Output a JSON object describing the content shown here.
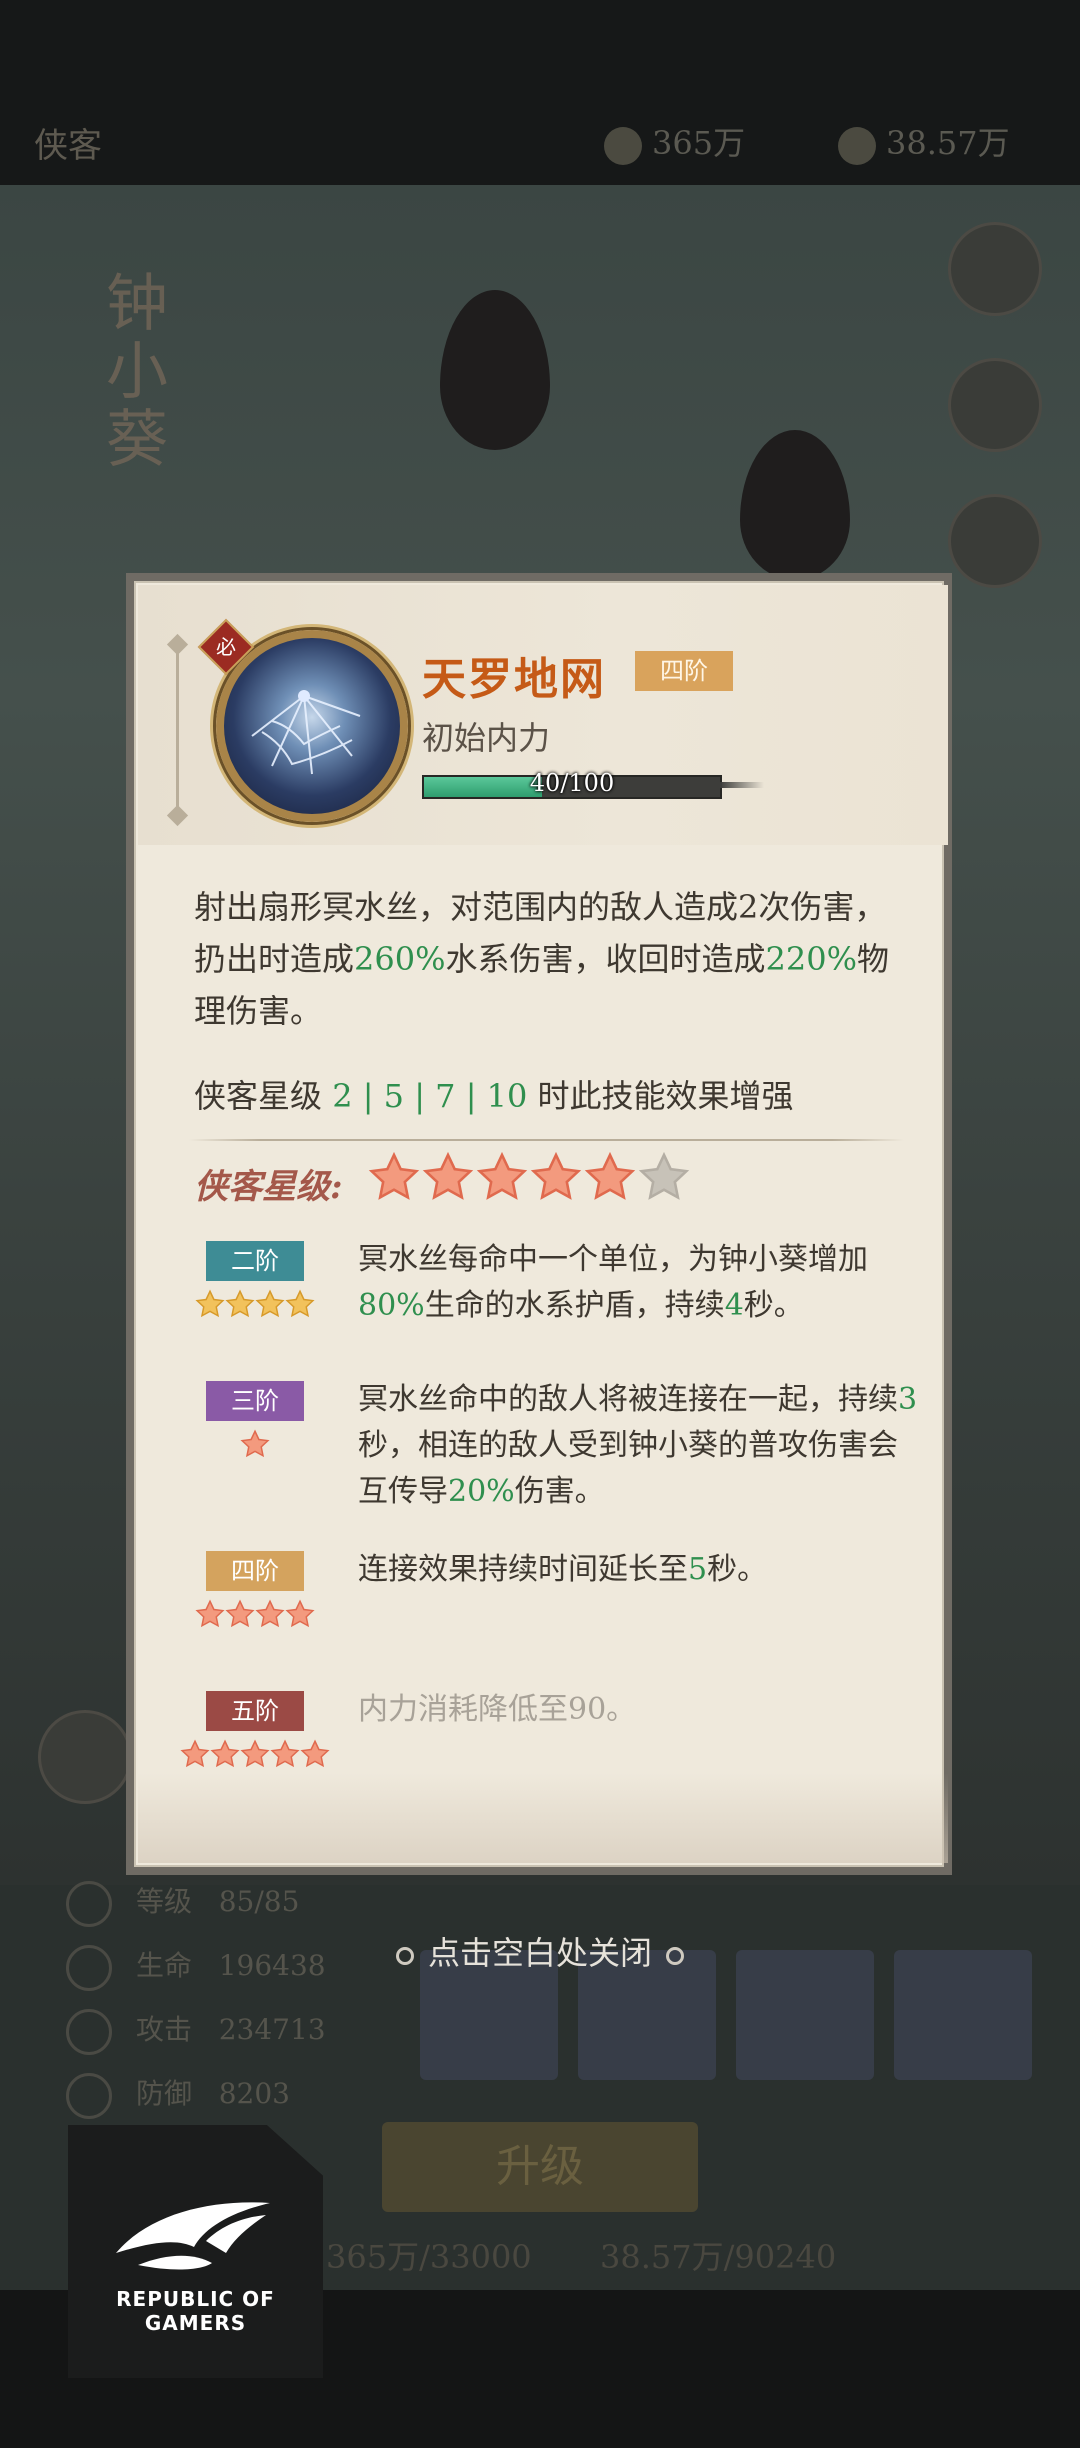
{
  "background": {
    "top_left_title": "侠客",
    "currency_1": "365万",
    "currency_2": "38.57万",
    "character_name": "钟小葵",
    "stats": [
      {
        "label": "等级",
        "value": "85/85"
      },
      {
        "label": "生命",
        "value": "196438"
      },
      {
        "label": "攻击",
        "value": "234713"
      },
      {
        "label": "防御",
        "value": "8203"
      }
    ],
    "upgrade_label": "升级",
    "cost_1": "365万/33000",
    "cost_2": "38.57万/90240"
  },
  "rog": {
    "line1": "REPUBLIC OF",
    "line2": "GAMERS"
  },
  "popup": {
    "skill_name": "天罗地网",
    "tier_badge": "四阶",
    "subtitle": "初始内力",
    "energy_text": "40/100",
    "energy_current": 40,
    "energy_max": 100,
    "must_badge": "必",
    "description": {
      "part1": "射出扇形冥水丝，对范围内的敌人造成2次伤害，扔出时造成",
      "value1": "260%",
      "part2": "水系伤害，收回时造成",
      "value2": "220%",
      "part3": "物理伤害。"
    },
    "boost": {
      "prefix": "侠客星级",
      "levels": "2 | 5 | 7 | 10",
      "suffix": "时此技能效果增强"
    },
    "star_label": "侠客星级:",
    "hero_stars": 5,
    "hero_stars_max": 6,
    "tiers": [
      {
        "tag": "二阶",
        "tag_color": "#3e8c95",
        "stars": 4,
        "star_color": "gold",
        "parts": [
          [
            "冥水丝每命中一个单位，为钟小葵增加",
            false
          ],
          [
            "80%",
            true
          ],
          [
            "生命的水系护盾，持续",
            false
          ],
          [
            "4",
            true
          ],
          [
            "秒。",
            false
          ]
        ]
      },
      {
        "tag": "三阶",
        "tag_color": "#8a5aa6",
        "stars": 1,
        "star_color": "red",
        "parts": [
          [
            "冥水丝命中的敌人将被连接在一起，持续",
            false
          ],
          [
            "3",
            true
          ],
          [
            "秒，相连的敌人受到钟小葵的普攻伤害会互传导",
            false
          ],
          [
            "20%",
            true
          ],
          [
            "伤害。",
            false
          ]
        ]
      },
      {
        "tag": "四阶",
        "tag_color": "#d4a35e",
        "stars": 4,
        "star_color": "red",
        "parts": [
          [
            "连接效果持续时间延长至",
            false
          ],
          [
            "5",
            true
          ],
          [
            "秒。",
            false
          ]
        ]
      },
      {
        "tag": "五阶",
        "tag_color": "#9b4a45",
        "stars": 5,
        "star_color": "red",
        "dim": true,
        "parts": [
          [
            "内力消耗降低至90。",
            false
          ]
        ]
      }
    ],
    "close_hint": "点击空白处关闭"
  }
}
